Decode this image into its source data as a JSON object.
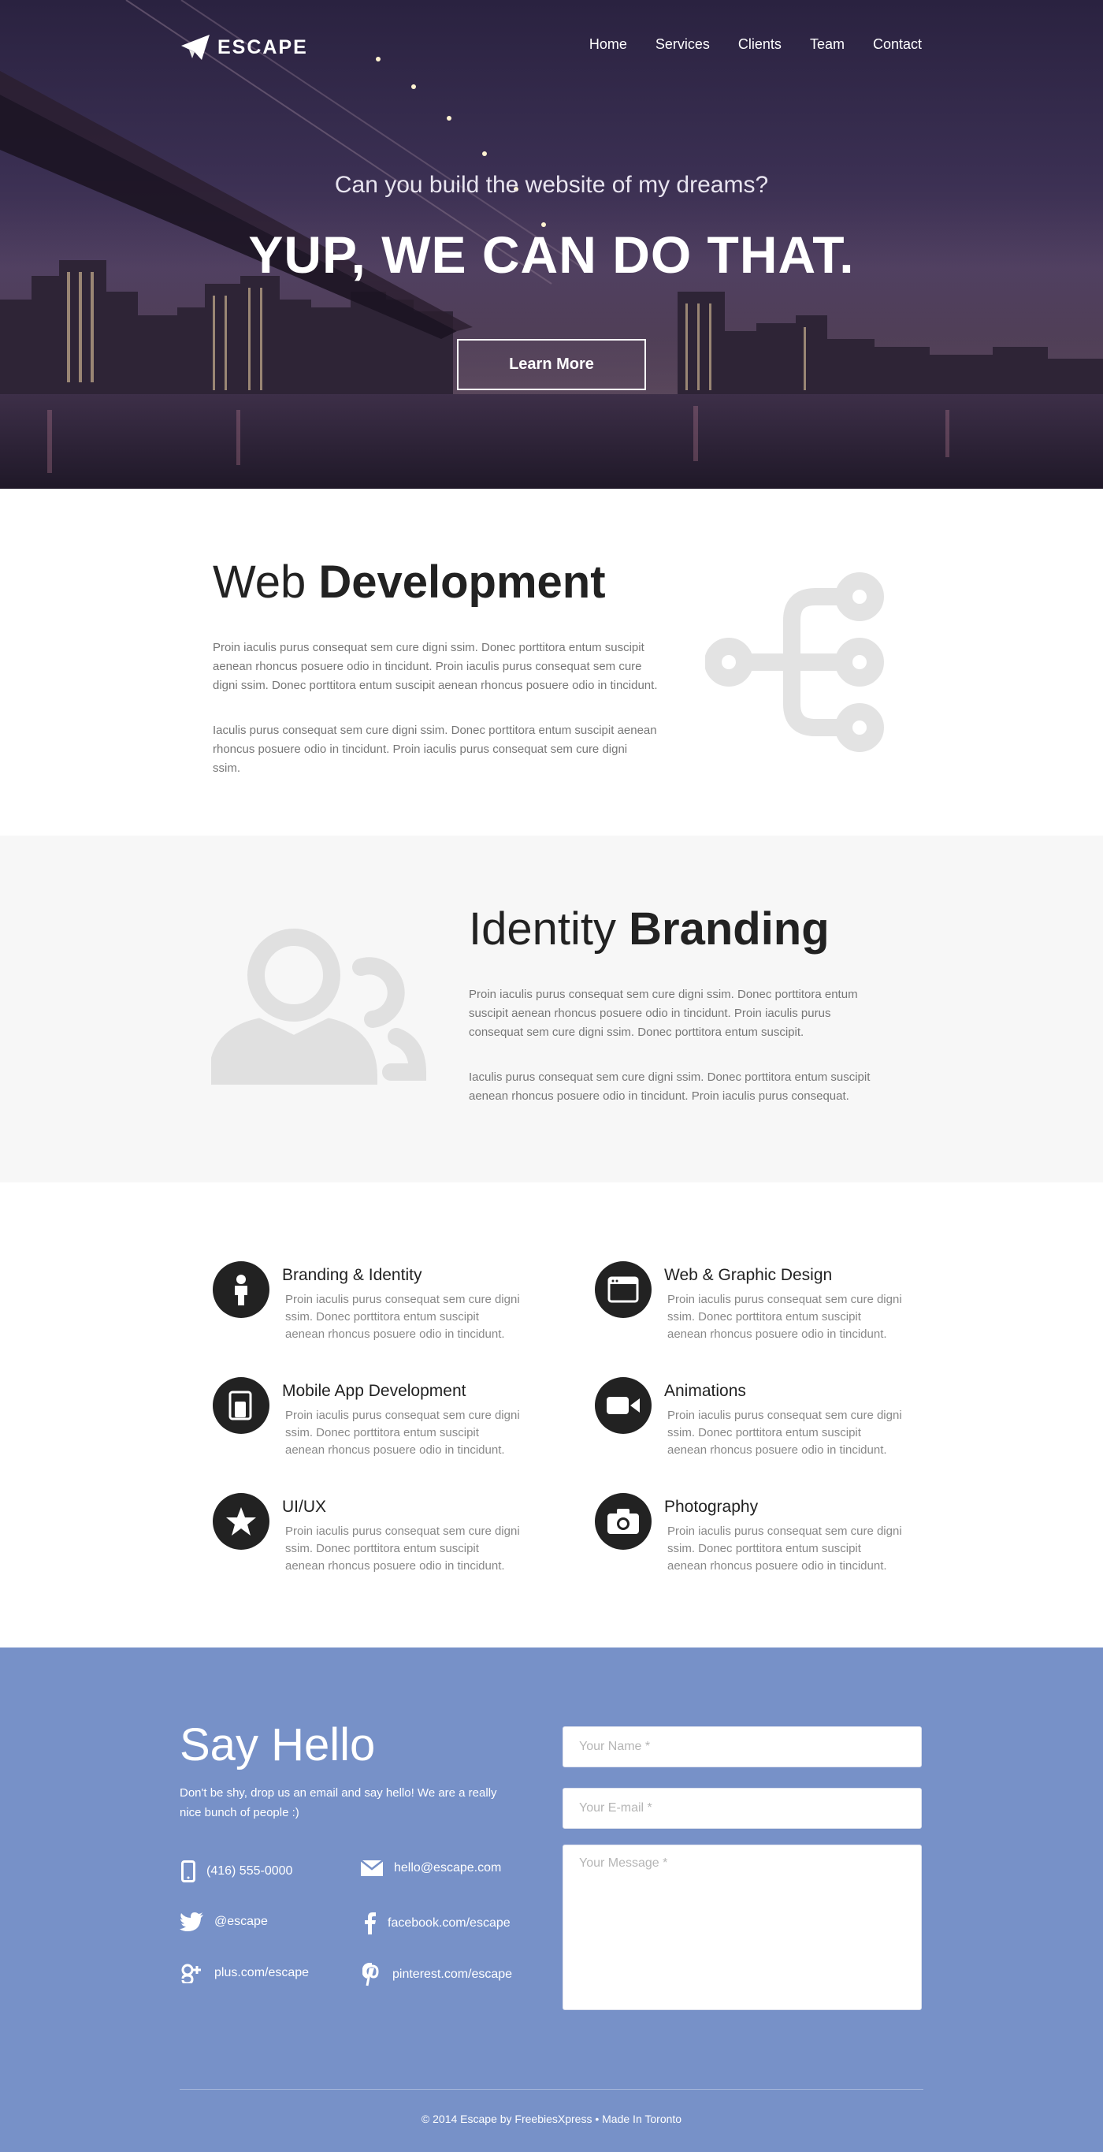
{
  "header": {
    "logo_text": "ESCAPE",
    "nav": [
      "Home",
      "Services",
      "Clients",
      "Team",
      "Contact"
    ]
  },
  "hero": {
    "tagline": "Can you build the website of my dreams?",
    "headline": "YUP, WE CAN DO THAT.",
    "cta_label": "Learn More"
  },
  "web_dev": {
    "title_light": "Web",
    "title_bold": "Development",
    "para1": "Proin iaculis purus consequat sem cure digni ssim. Donec porttitora entum suscipit aenean rhoncus posuere odio in tincidunt. Proin iaculis purus consequat sem cure digni ssim. Donec porttitora entum suscipit aenean rhoncus posuere odio in tincidunt.",
    "para2": "Iaculis purus consequat sem cure digni ssim. Donec porttitora entum suscipit aenean rhoncus posuere odio in tincidunt. Proin iaculis purus consequat sem cure digni ssim."
  },
  "branding": {
    "title_light": "Identity",
    "title_bold": "Branding",
    "para1": "Proin iaculis purus consequat sem cure digni ssim. Donec porttitora entum suscipit aenean rhoncus posuere odio in tincidunt. Proin iaculis purus consequat sem cure digni ssim. Donec porttitora entum suscipit.",
    "para2": "Iaculis purus consequat sem cure digni ssim. Donec porttitora entum suscipit aenean rhoncus posuere odio in tincidunt. Proin iaculis purus consequat."
  },
  "services": [
    {
      "title": "Branding & Identity",
      "icon": "person-icon",
      "desc": "Proin iaculis purus consequat sem cure digni ssim. Donec porttitora entum suscipit aenean rhoncus posuere odio in tincidunt."
    },
    {
      "title": "Web & Graphic Design",
      "icon": "browser-window-icon",
      "desc": "Proin iaculis purus consequat sem cure digni ssim. Donec porttitora entum suscipit aenean rhoncus posuere odio in tincidunt."
    },
    {
      "title": "Mobile App Development",
      "icon": "devices-icon",
      "desc": "Proin iaculis purus consequat sem cure digni ssim. Donec porttitora entum suscipit aenean rhoncus posuere odio in tincidunt."
    },
    {
      "title": "Animations",
      "icon": "video-camera-icon",
      "desc": "Proin iaculis purus consequat sem cure digni ssim. Donec porttitora entum suscipit aenean rhoncus posuere odio in tincidunt."
    },
    {
      "title": "UI/UX",
      "icon": "star-icon",
      "desc": "Proin iaculis purus consequat sem cure digni ssim. Donec porttitora entum suscipit aenean rhoncus posuere odio in tincidunt."
    },
    {
      "title": "Photography",
      "icon": "camera-icon",
      "desc": "Proin iaculis purus consequat sem cure digni ssim. Donec porttitora entum suscipit aenean rhoncus posuere odio in tincidunt."
    }
  ],
  "contact": {
    "title_light": "Say",
    "title_bold": "Hello",
    "intro": "Don't be shy, drop us an email and say hello! We are a really nice bunch of people :)",
    "phone": "(416) 555-0000",
    "email": "hello@escape.com",
    "twitter": "@escape",
    "facebook": "facebook.com/escape",
    "googleplus": "plus.com/escape",
    "pinterest": "pinterest.com/escape",
    "form": {
      "name_placeholder": "Your Name *",
      "email_placeholder": "Your E-mail *",
      "message_placeholder": "Your Message *"
    }
  },
  "footer": {
    "text": "© 2014 Escape by FreebiesXpress • Made In Toronto"
  },
  "colors": {
    "hero_bg": "#2a2240",
    "contact_bg": "#7791c8",
    "dark": "#222222",
    "icon_gray": "#dddddd"
  }
}
